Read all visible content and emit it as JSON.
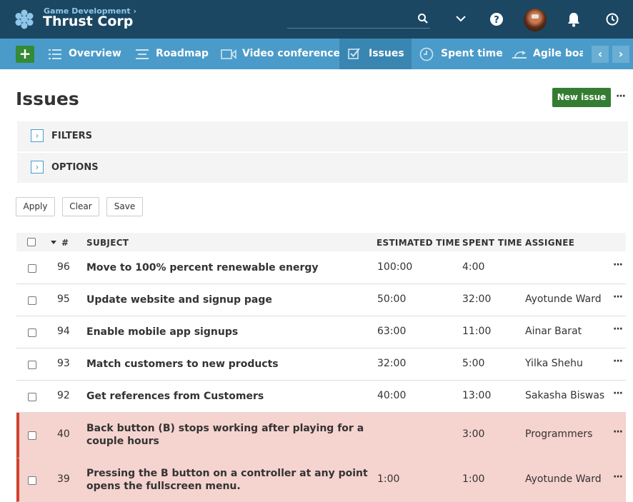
{
  "header": {
    "breadcrumb": "Game Development ›",
    "project_name": "Thrust Corp",
    "search_placeholder": ""
  },
  "icons": {
    "logo": "openproject-logo-icon",
    "search": "search-icon",
    "dropdown": "chevron-down-icon",
    "help": "help-icon",
    "notifications": "bell-icon",
    "time": "clock-icon"
  },
  "nav": {
    "items": [
      {
        "label": "Overview",
        "icon": "list-icon"
      },
      {
        "label": "Roadmap",
        "icon": "roadmap-icon"
      },
      {
        "label": "Video conference",
        "icon": "video-icon"
      },
      {
        "label": "Issues",
        "icon": "checkbox-icon",
        "active": true
      },
      {
        "label": "Spent time",
        "icon": "clock-icon"
      },
      {
        "label": "Agile boards",
        "icon": "agile-icon"
      }
    ],
    "prev": "‹",
    "next": "›"
  },
  "page": {
    "title": "Issues",
    "new_issue": "New issue",
    "filters_label": "FILTERS",
    "options_label": "OPTIONS",
    "apply": "Apply",
    "clear": "Clear",
    "save": "Save"
  },
  "table": {
    "columns": [
      "#",
      "SUBJECT",
      "ESTIMATED TIME",
      "SPENT TIME",
      "ASSIGNEE"
    ],
    "rows": [
      {
        "id": "96",
        "subject": "Move to 100% percent renewable energy",
        "estimated": "100:00",
        "spent": "4:00",
        "assignee": "",
        "highlight": false
      },
      {
        "id": "95",
        "subject": "Update website and signup page",
        "estimated": "50:00",
        "spent": "32:00",
        "assignee": "Ayotunde Ward",
        "highlight": false
      },
      {
        "id": "94",
        "subject": "Enable mobile app signups",
        "estimated": "63:00",
        "spent": "11:00",
        "assignee": "Ainar Barat",
        "highlight": false
      },
      {
        "id": "93",
        "subject": "Match customers to new products",
        "estimated": "32:00",
        "spent": "5:00",
        "assignee": "Yilka Shehu",
        "highlight": false
      },
      {
        "id": "92",
        "subject": "Get references from Customers",
        "estimated": "40:00",
        "spent": "13:00",
        "assignee": "Sakasha Biswas",
        "highlight": false
      },
      {
        "id": "40",
        "subject": "Back button (B) stops working after playing for a couple hours",
        "estimated": "",
        "spent": "3:00",
        "assignee": "Programmers",
        "highlight": true
      },
      {
        "id": "39",
        "subject": "Pressing the B button on a controller at any point opens the fullscreen menu.",
        "estimated": "1:00",
        "spent": "1:00",
        "assignee": "Ayotunde Ward",
        "highlight": true
      }
    ]
  },
  "colors": {
    "header_bg": "#1b4763",
    "nav_bg": "#4a9bc9",
    "primary_button": "#357c33",
    "highlight_row": "#f5d3cf",
    "highlight_border": "#d0422c"
  }
}
